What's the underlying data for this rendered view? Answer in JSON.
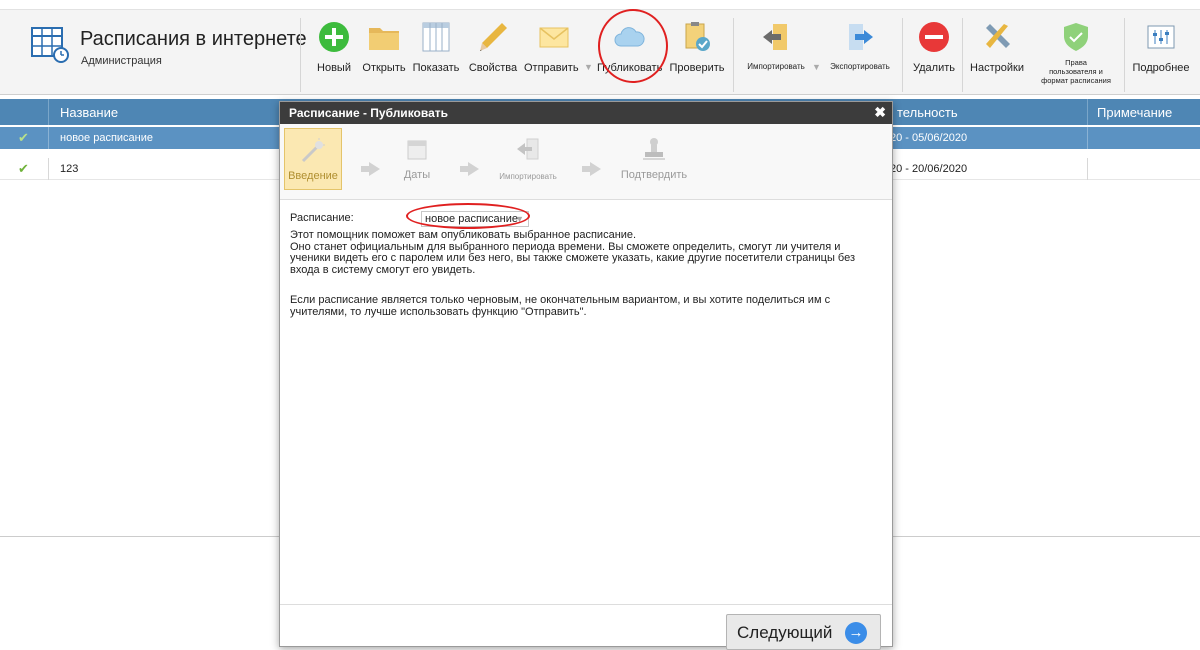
{
  "app": {
    "title": "Расписания в интернете",
    "subtitle": "Администрация"
  },
  "toolbar": {
    "new": "Новый",
    "open": "Открыть",
    "show": "Показать",
    "properties": "Свойства",
    "send": "Отправить",
    "publish": "Публиковать",
    "check": "Проверить",
    "import": "Импортировать",
    "export": "Экспортировать",
    "delete": "Удалить",
    "settings": "Настройки",
    "rights_line1": "Права",
    "rights_line2": "пользователя и",
    "rights_line3": "формат расписания",
    "more": "Подробнее"
  },
  "grid": {
    "columns": {
      "name": "Название",
      "validity": "тельность",
      "note": "Примечание"
    },
    "rows": [
      {
        "name": "новое расписание",
        "validity": "20 - 05/06/2020",
        "note": "",
        "selected": true
      },
      {
        "name": "123",
        "validity": "20 - 20/06/2020",
        "note": "",
        "selected": false
      }
    ]
  },
  "dialog": {
    "title": "Расписание - Публиковать",
    "close": "✖",
    "steps": [
      {
        "label": "Введение",
        "active": true
      },
      {
        "label": "Даты",
        "active": false
      },
      {
        "label": "Импортировать",
        "active": false
      },
      {
        "label": "Подтвердить",
        "active": false
      }
    ],
    "schedule_label": "Расписание:",
    "schedule_value": "новое расписание",
    "intro_line1": "Этот помощник поможет вам опубликовать выбранное расписание.",
    "intro_line2": "Оно станет официальным для выбранного периода времени. Вы сможете определить, смогут ли учителя и ученики видеть его с паролем или без него, вы также сможете указать, какие другие посетители страницы без входа в систему смогут его увидеть.",
    "paragraph2": "Если расписание является только черновым, не окончательным вариантом, и вы хотите поделиться им с учителями, то лучше использовать функцию \"Отправить\".",
    "next": "Следующий"
  },
  "colors": {
    "header_blue": "#4e86b4",
    "selected_row": "#5b92c2",
    "dialog_title": "#3c3c3c",
    "annotation_red": "#e02020"
  }
}
